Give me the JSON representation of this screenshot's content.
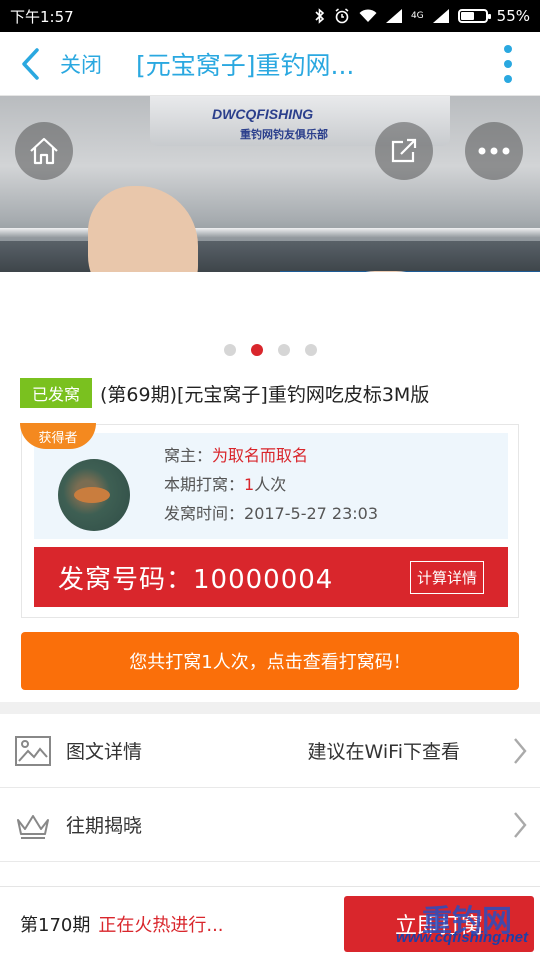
{
  "status_bar": {
    "time": "下午1:57",
    "network": "4G",
    "battery_percent": "55%",
    "battery_level": 0.55,
    "icons": [
      "bluetooth-icon",
      "alarm-icon",
      "wifi-icon",
      "signal-icon",
      "signal-icon",
      "battery-icon"
    ]
  },
  "nav": {
    "close_label": "关闭",
    "title": "[元宝窝子]重钓网..."
  },
  "hero": {
    "plate_text": "DWCQFISHING",
    "plate_sub": "重钓网钓友俱乐部",
    "slide_count": 4,
    "active_slide": 2
  },
  "product": {
    "status_badge": "已发窝",
    "title": "(第69期)[元宝窝子]重钓网吃皮标3M版"
  },
  "winner": {
    "ribbon": "获得者",
    "owner_label": "窝主：",
    "owner_name": "为取名而取名",
    "period_label": "本期打窝：",
    "period_count": "1",
    "period_unit": "人次",
    "time_label": "发窝时间：",
    "time_value": "2017-5-27 23:03"
  },
  "code_bar": {
    "label": "发窝号码：10000004",
    "calc_label": "计算详情"
  },
  "orange_button": "您共打窝1人次，点击查看打窝码！",
  "rows": [
    {
      "label": "图文详情",
      "hint": "建议在WiFi下查看"
    },
    {
      "label": "往期揭晓",
      "hint": ""
    }
  ],
  "bottom": {
    "period": "第170期",
    "hot": "正在火热进行...",
    "button": "立即打窝",
    "watermark": "www.cqfishing.net",
    "watermark_big": "重钓网"
  },
  "colors": {
    "accent_blue": "#2aa8e0",
    "red": "#d9262c",
    "orange": "#fa6f0a",
    "green_badge": "#7ac11f"
  }
}
